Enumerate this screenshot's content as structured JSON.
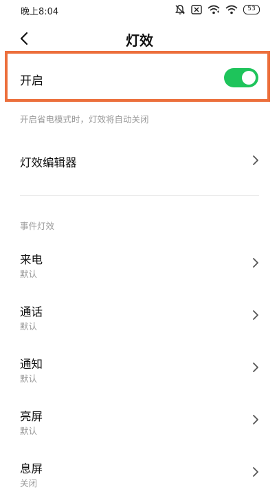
{
  "status_bar": {
    "time": "晚上8:04",
    "battery": "53"
  },
  "header": {
    "title": "灯效"
  },
  "enable": {
    "label": "开启",
    "on": true,
    "switch_color": "#1ec45b",
    "highlight_color": "#ec6f3c"
  },
  "hint": "开启省电模式时，灯效将自动关闭",
  "editor": {
    "label": "灯效编辑器"
  },
  "events": {
    "section_title": "事件灯效",
    "items": [
      {
        "label": "来电",
        "value": "默认"
      },
      {
        "label": "通话",
        "value": "默认"
      },
      {
        "label": "通知",
        "value": "默认"
      },
      {
        "label": "亮屏",
        "value": "默认"
      },
      {
        "label": "息屏",
        "value": "关闭"
      }
    ]
  }
}
